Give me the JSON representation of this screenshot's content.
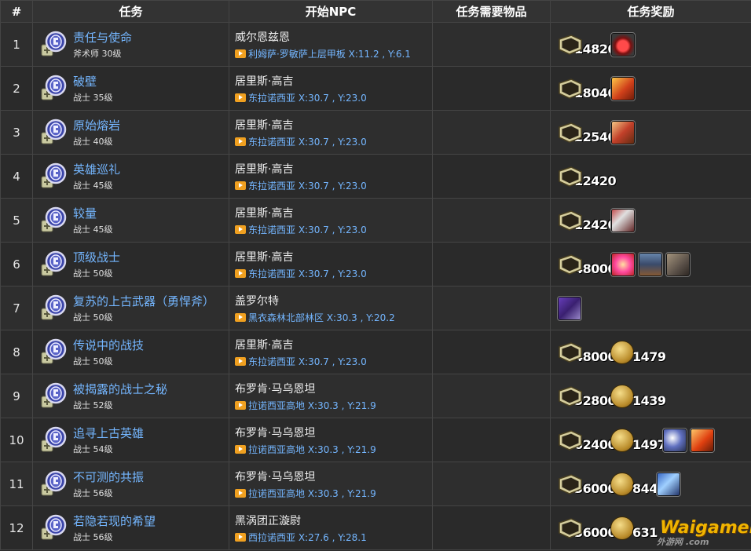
{
  "headers": {
    "num": "#",
    "task": "任务",
    "npc": "开始NPC",
    "items": "任务需要物品",
    "rewards": "任务奖励"
  },
  "rows": [
    {
      "num": "1",
      "name": "责任与使命",
      "level": "斧术师 30级",
      "npc": "威尔恩兹恩",
      "loc": "利姆萨·罗敏萨上层甲板 X:11.2 , Y:6.1",
      "exp": "14820",
      "gil": null,
      "items": [
        "heart-item-icon"
      ]
    },
    {
      "num": "2",
      "name": "破壁",
      "level": "战士 35级",
      "npc": "居里斯·高吉",
      "loc": "东拉诺西亚 X:30.7 , Y:23.0",
      "exp": "18040",
      "gil": null,
      "items": [
        "warrior-skill-icon"
      ]
    },
    {
      "num": "3",
      "name": "原始熔岩",
      "level": "战士 40级",
      "npc": "居里斯·高吉",
      "loc": "东拉诺西亚 X:30.7 , Y:23.0",
      "exp": "22540",
      "gil": null,
      "items": [
        "axe-skill-icon"
      ]
    },
    {
      "num": "4",
      "name": "英雄巡礼",
      "level": "战士 45级",
      "npc": "居里斯·高吉",
      "loc": "东拉诺西亚 X:30.7 , Y:23.0",
      "exp": "12420",
      "gil": null,
      "items": []
    },
    {
      "num": "5",
      "name": "较量",
      "level": "战士 45级",
      "npc": "居里斯·高吉",
      "loc": "东拉诺西亚 X:30.7 , Y:23.0",
      "exp": "12420",
      "gil": null,
      "items": [
        "slash-skill-icon"
      ]
    },
    {
      "num": "6",
      "name": "顶级战士",
      "level": "战士 50级",
      "npc": "居里斯·高吉",
      "loc": "东拉诺西亚 X:30.7 , Y:23.0",
      "exp": "48000",
      "gil": null,
      "items": [
        "burst-skill-icon",
        "armor-body-icon",
        "armor-gauntlet-icon"
      ]
    },
    {
      "num": "7",
      "name": "复苏的上古武器（勇悍斧）",
      "level": "战士 50级",
      "npc": "盖罗尔特",
      "loc": "黑衣森林北部林区 X:30.3 , Y:20.2",
      "exp": null,
      "gil": null,
      "items": [
        "relic-axe-icon"
      ]
    },
    {
      "num": "8",
      "name": "传说中的战技",
      "level": "战士 50级",
      "npc": "居里斯·高吉",
      "loc": "东拉诺西亚 X:30.7 , Y:23.0",
      "exp": "48000",
      "gil": "1479",
      "items": []
    },
    {
      "num": "9",
      "name": "被揭露的战士之秘",
      "level": "战士 52级",
      "npc": "布罗肯·马乌恩坦",
      "loc": "拉诺西亚高地 X:30.3 , Y:21.9",
      "exp": "52800",
      "gil": "1439",
      "items": []
    },
    {
      "num": "10",
      "name": "追寻上古英雄",
      "level": "战士 54级",
      "npc": "布罗肯·马乌恩坦",
      "loc": "拉诺西亚高地 X:30.3 , Y:21.9",
      "exp": "62400",
      "gil": "1497",
      "items": [
        "whirl-skill-icon",
        "fire-skill-icon"
      ]
    },
    {
      "num": "11",
      "name": "不可测的共振",
      "level": "战士 56级",
      "npc": "布罗肯·马乌恩坦",
      "loc": "拉诺西亚高地 X:30.3 , Y:21.9",
      "exp": "36000",
      "gil": "844",
      "items": [
        "blue-slash-skill-icon"
      ]
    },
    {
      "num": "12",
      "name": "若隐若现的希望",
      "level": "战士 56级",
      "npc": "黑涡团正漩尉",
      "loc": "西拉诺西亚 X:27.6 , Y:28.1",
      "exp": "36000",
      "gil": "631",
      "items": []
    }
  ],
  "colors": {
    "link": "#74b6ff",
    "header_bg": "#333333",
    "location_icon": "#f0a020"
  },
  "watermark": {
    "main": "Waigamer",
    "sub": "外游网 .com"
  }
}
